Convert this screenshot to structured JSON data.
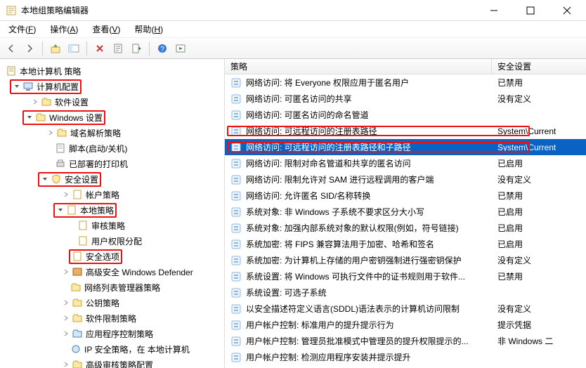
{
  "window": {
    "title": "本地组策略编辑器"
  },
  "menu": {
    "file": "文件",
    "file_accel": "F",
    "action": "操作",
    "action_accel": "A",
    "view": "查看",
    "view_accel": "V",
    "help": "帮助",
    "help_accel": "H"
  },
  "columns": {
    "policy": "策略",
    "setting": "安全设置"
  },
  "tree": {
    "root": "本地计算机 策略",
    "computer_config": "计算机配置",
    "software_settings": "软件设置",
    "windows_settings": "Windows 设置",
    "name_resolution": "域名解析策略",
    "scripts": "脚本(启动/关机)",
    "deployed_printers": "已部署的打印机",
    "security_settings": "安全设置",
    "account_policies": "帐户策略",
    "local_policies": "本地策略",
    "audit_policy": "审核策略",
    "user_rights": "用户权限分配",
    "security_options": "安全选项",
    "defender": "高级安全 Windows Defender",
    "network_list": "网络列表管理器策略",
    "public_key": "公钥策略",
    "software_restriction": "软件限制策略",
    "app_control": "应用程序控制策略",
    "ipsec": "IP 安全策略，在 本地计算机",
    "advanced_audit": "高级审核策略配置"
  },
  "rows": [
    {
      "name": "网络访问: 将 Everyone 权限应用于匿名用户",
      "value": "已禁用"
    },
    {
      "name": "网络访问: 可匿名访问的共享",
      "value": "没有定义"
    },
    {
      "name": "网络访问: 可匿名访问的命名管道",
      "value": ""
    },
    {
      "name": "网络访问: 可远程访问的注册表路径",
      "value": "System\\Current"
    },
    {
      "name": "网络访问: 可远程访问的注册表路径和子路径",
      "value": "System\\Current"
    },
    {
      "name": "网络访问: 限制对命名管道和共享的匿名访问",
      "value": "已启用"
    },
    {
      "name": "网络访问: 限制允许对 SAM 进行远程调用的客户端",
      "value": "没有定义"
    },
    {
      "name": "网络访问: 允许匿名 SID/名称转换",
      "value": "已禁用"
    },
    {
      "name": "系统对象: 非 Windows 子系统不要求区分大小写",
      "value": "已启用"
    },
    {
      "name": "系统对象: 加强内部系统对象的默认权限(例如，符号链接)",
      "value": "已启用"
    },
    {
      "name": "系统加密: 将 FIPS 兼容算法用于加密、哈希和签名",
      "value": "已启用"
    },
    {
      "name": "系统加密: 为计算机上存储的用户密钥强制进行强密钥保护",
      "value": "没有定义"
    },
    {
      "name": "系统设置: 将 Windows 可执行文件中的证书规则用于软件...",
      "value": "已禁用"
    },
    {
      "name": "系统设置: 可选子系统",
      "value": ""
    },
    {
      "name": "以安全描述符定义语言(SDDL)语法表示的计算机访问限制",
      "value": "没有定义"
    },
    {
      "name": "用户帐户控制: 标准用户的提升提示行为",
      "value": "提示凭据"
    },
    {
      "name": "用户帐户控制: 管理员批准模式中管理员的提升权限提示的...",
      "value": "非 Windows 二"
    },
    {
      "name": "用户帐户控制: 检测应用程序安装并提示提升",
      "value": ""
    }
  ]
}
